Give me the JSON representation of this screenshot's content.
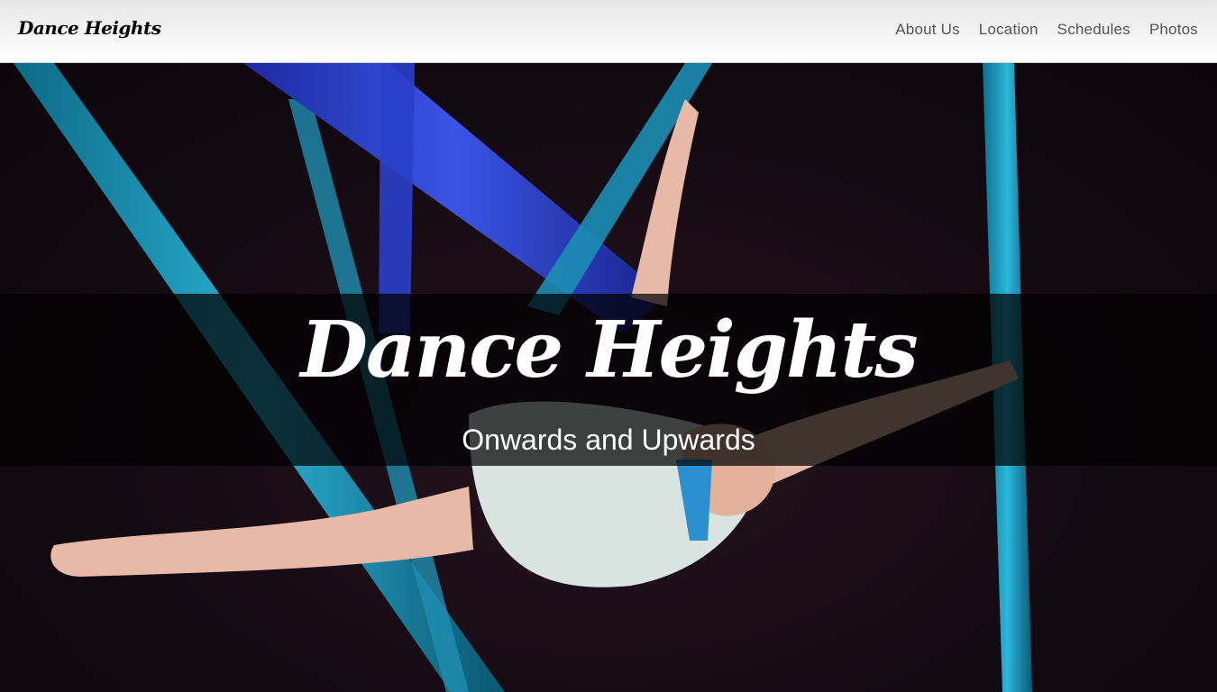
{
  "navbar": {
    "brand": "Dance Heights",
    "links": [
      {
        "label": "About Us"
      },
      {
        "label": "Location"
      },
      {
        "label": "Schedules"
      },
      {
        "label": "Photos"
      }
    ]
  },
  "hero": {
    "title": "Dance Heights",
    "subtitle": "Onwards and Upwards",
    "photo": "aerial-silks-dancer",
    "colors": {
      "silk_blue": "#2a3fc9",
      "silk_teal": "#1aa0c4",
      "background": "#140a12",
      "skin": "#e7b9a6"
    }
  }
}
